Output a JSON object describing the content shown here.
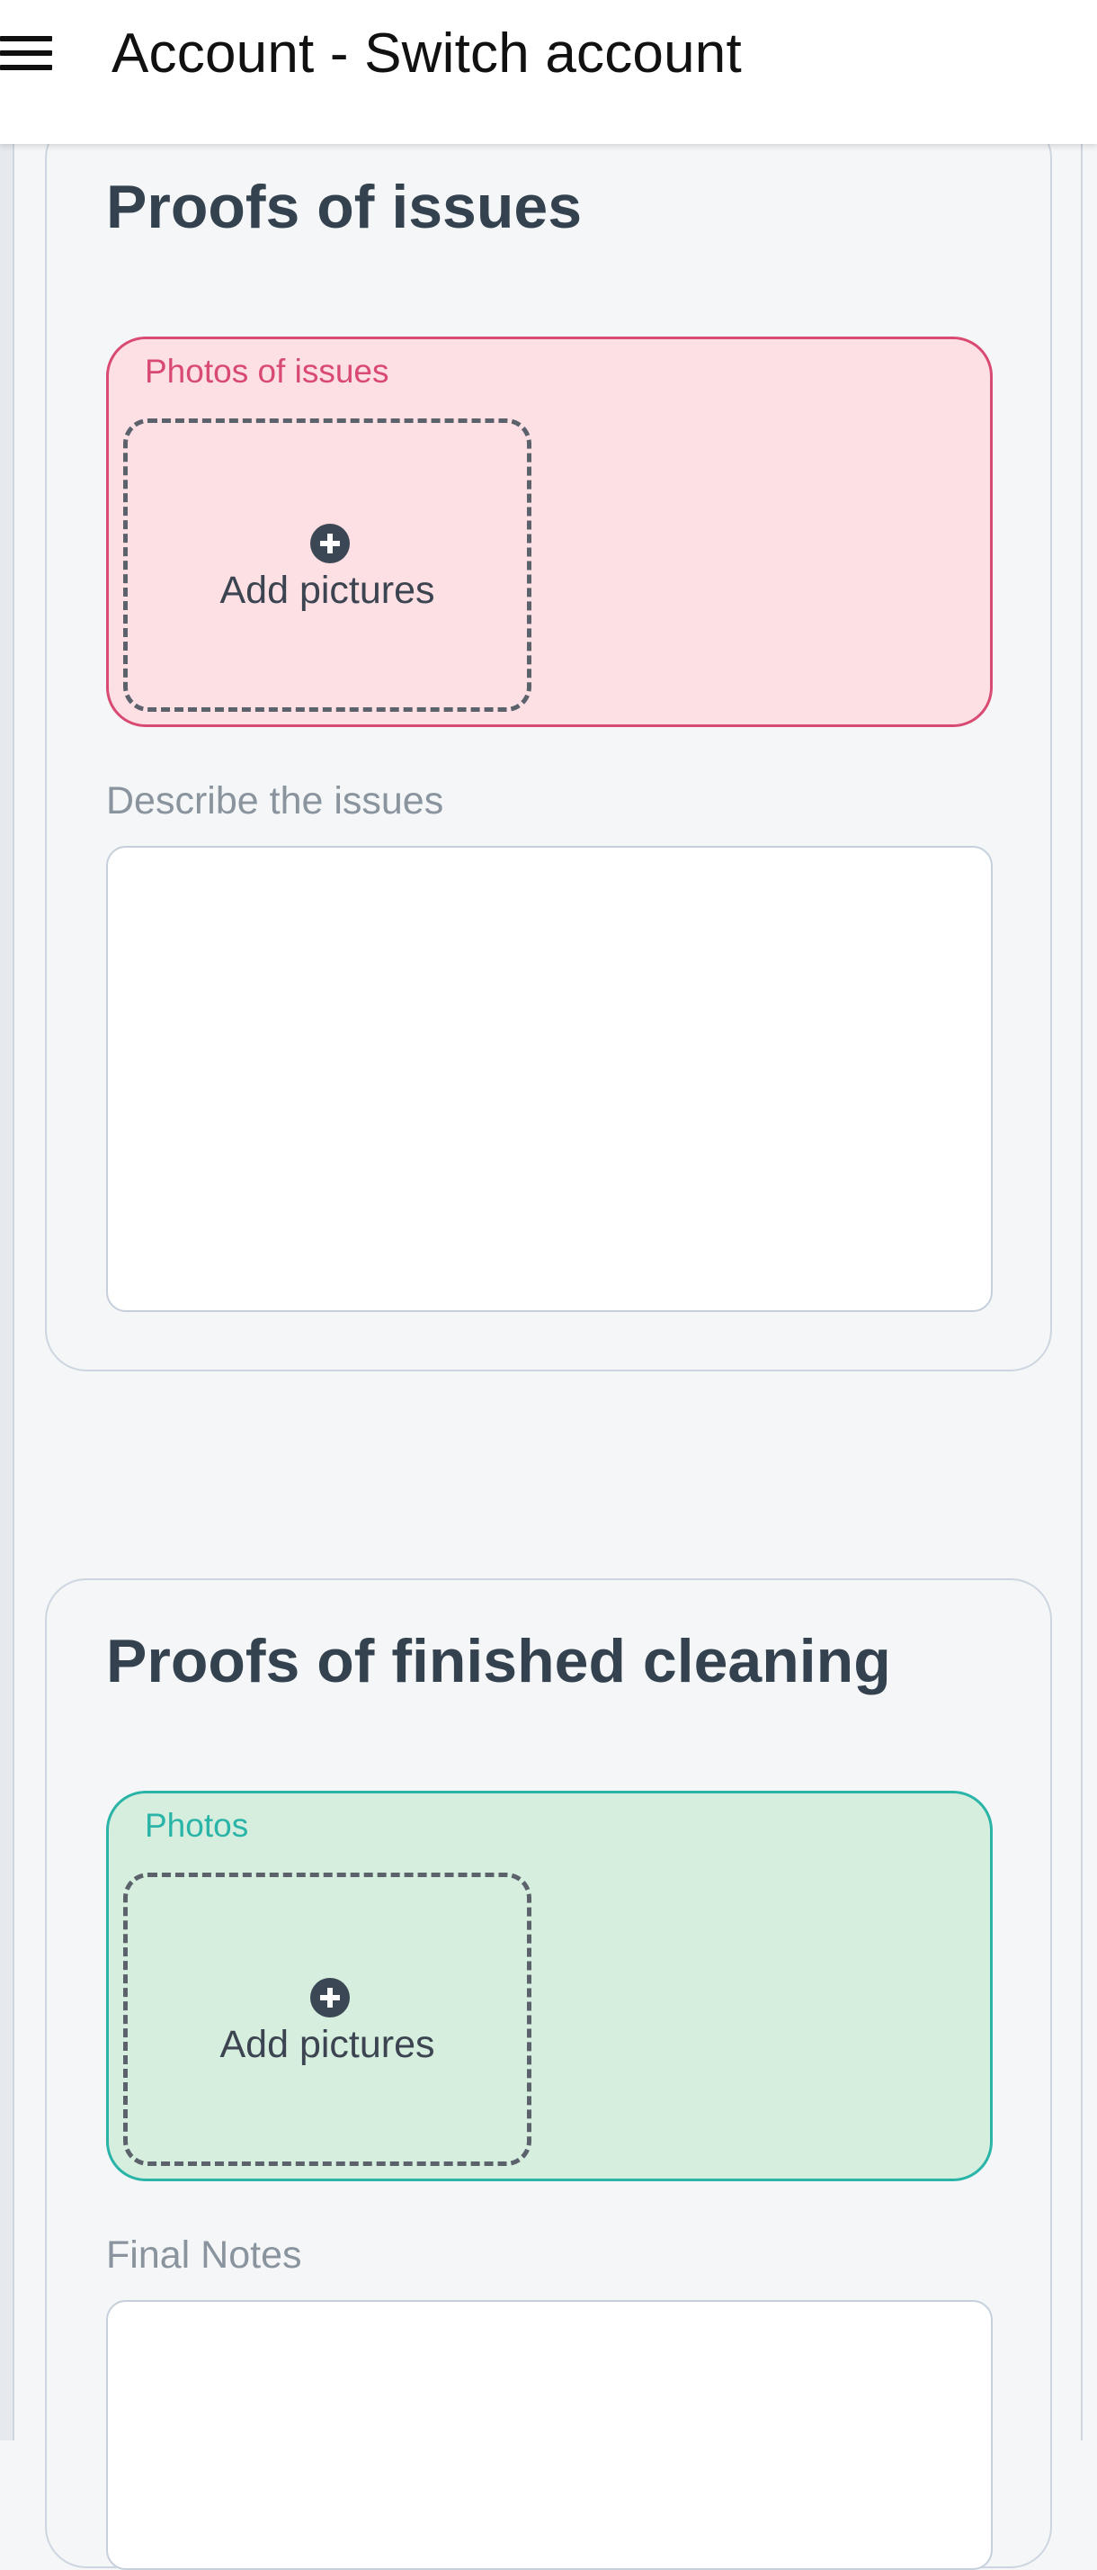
{
  "header": {
    "title": "Account - Switch account",
    "menu_icon": "hamburger-menu-icon"
  },
  "issues_section": {
    "title": "Proofs of issues",
    "photos": {
      "label": "Photos of issues",
      "add_label": "Add pictures",
      "icon": "plus-circle-icon",
      "accent_color": "#d94a72",
      "background_color": "#fde0e4"
    },
    "description": {
      "label": "Describe the issues",
      "value": ""
    }
  },
  "finished_section": {
    "title": "Proofs of finished cleaning",
    "photos": {
      "label": "Photos",
      "add_label": "Add pictures",
      "icon": "plus-circle-icon",
      "accent_color": "#2ab4a8",
      "background_color": "#d6eede"
    },
    "notes": {
      "label": "Final Notes",
      "value": ""
    }
  }
}
